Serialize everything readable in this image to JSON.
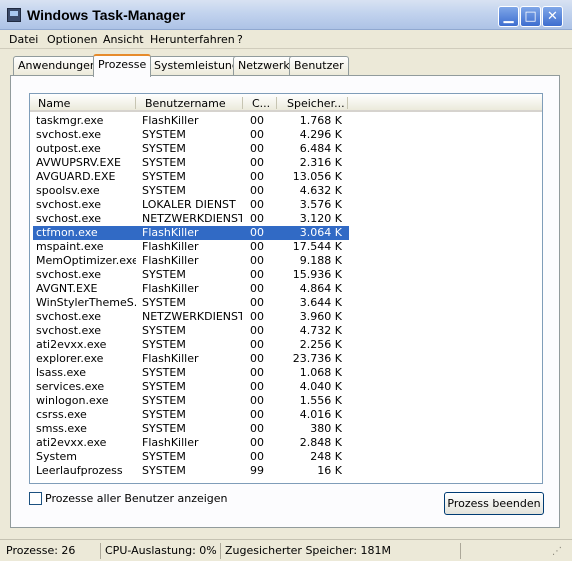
{
  "window": {
    "title": "Windows Task-Manager"
  },
  "menu": [
    "Datei",
    "Optionen",
    "Ansicht",
    "Herunterfahren",
    "?"
  ],
  "tabs": [
    "Anwendungen",
    "Prozesse",
    "Systemleistung",
    "Netzwerk",
    "Benutzer"
  ],
  "active_tab": "Prozesse",
  "columns": {
    "name": "Name",
    "user": "Benutzername",
    "cpu": "C...",
    "mem": "Speicher..."
  },
  "processes": [
    {
      "name": "taskmgr.exe",
      "user": "FlashKiller",
      "cpu": "00",
      "mem": "1.768 K"
    },
    {
      "name": "svchost.exe",
      "user": "SYSTEM",
      "cpu": "00",
      "mem": "4.296 K"
    },
    {
      "name": "outpost.exe",
      "user": "SYSTEM",
      "cpu": "00",
      "mem": "6.484 K"
    },
    {
      "name": "AVWUPSRV.EXE",
      "user": "SYSTEM",
      "cpu": "00",
      "mem": "2.316 K"
    },
    {
      "name": "AVGUARD.EXE",
      "user": "SYSTEM",
      "cpu": "00",
      "mem": "13.056 K"
    },
    {
      "name": "spoolsv.exe",
      "user": "SYSTEM",
      "cpu": "00",
      "mem": "4.632 K"
    },
    {
      "name": "svchost.exe",
      "user": "LOKALER DIENST",
      "cpu": "00",
      "mem": "3.576 K"
    },
    {
      "name": "svchost.exe",
      "user": "NETZWERKDIENST",
      "cpu": "00",
      "mem": "3.120 K"
    },
    {
      "name": "ctfmon.exe",
      "user": "FlashKiller",
      "cpu": "00",
      "mem": "3.064 K"
    },
    {
      "name": "mspaint.exe",
      "user": "FlashKiller",
      "cpu": "00",
      "mem": "17.544 K"
    },
    {
      "name": "MemOptimizer.exe",
      "user": "FlashKiller",
      "cpu": "00",
      "mem": "9.188 K"
    },
    {
      "name": "svchost.exe",
      "user": "SYSTEM",
      "cpu": "00",
      "mem": "15.936 K"
    },
    {
      "name": "AVGNT.EXE",
      "user": "FlashKiller",
      "cpu": "00",
      "mem": "4.864 K"
    },
    {
      "name": "WinStylerThemeS...",
      "user": "SYSTEM",
      "cpu": "00",
      "mem": "3.644 K"
    },
    {
      "name": "svchost.exe",
      "user": "NETZWERKDIENST",
      "cpu": "00",
      "mem": "3.960 K"
    },
    {
      "name": "svchost.exe",
      "user": "SYSTEM",
      "cpu": "00",
      "mem": "4.732 K"
    },
    {
      "name": "ati2evxx.exe",
      "user": "SYSTEM",
      "cpu": "00",
      "mem": "2.256 K"
    },
    {
      "name": "explorer.exe",
      "user": "FlashKiller",
      "cpu": "00",
      "mem": "23.736 K"
    },
    {
      "name": "lsass.exe",
      "user": "SYSTEM",
      "cpu": "00",
      "mem": "1.068 K"
    },
    {
      "name": "services.exe",
      "user": "SYSTEM",
      "cpu": "00",
      "mem": "4.040 K"
    },
    {
      "name": "winlogon.exe",
      "user": "SYSTEM",
      "cpu": "00",
      "mem": "1.556 K"
    },
    {
      "name": "csrss.exe",
      "user": "SYSTEM",
      "cpu": "00",
      "mem": "4.016 K"
    },
    {
      "name": "smss.exe",
      "user": "SYSTEM",
      "cpu": "00",
      "mem": "380 K"
    },
    {
      "name": "ati2evxx.exe",
      "user": "FlashKiller",
      "cpu": "00",
      "mem": "2.848 K"
    },
    {
      "name": "System",
      "user": "SYSTEM",
      "cpu": "00",
      "mem": "248 K"
    },
    {
      "name": "Leerlaufprozess",
      "user": "SYSTEM",
      "cpu": "99",
      "mem": "16 K"
    }
  ],
  "selected_process": "ctfmon.exe",
  "show_all_users": {
    "label": "Prozesse aller Benutzer anzeigen",
    "checked": false
  },
  "end_process_button": "Prozess beenden",
  "statusbar": {
    "processes": "Prozesse: 26",
    "cpu": "CPU-Auslastung: 0%",
    "commit": "Zugesicherter Speicher: 181M"
  },
  "colors": {
    "selection": "#316ac5",
    "title_gradient_top": "#d8e2f2",
    "tab_highlight": "#e68b2c"
  }
}
